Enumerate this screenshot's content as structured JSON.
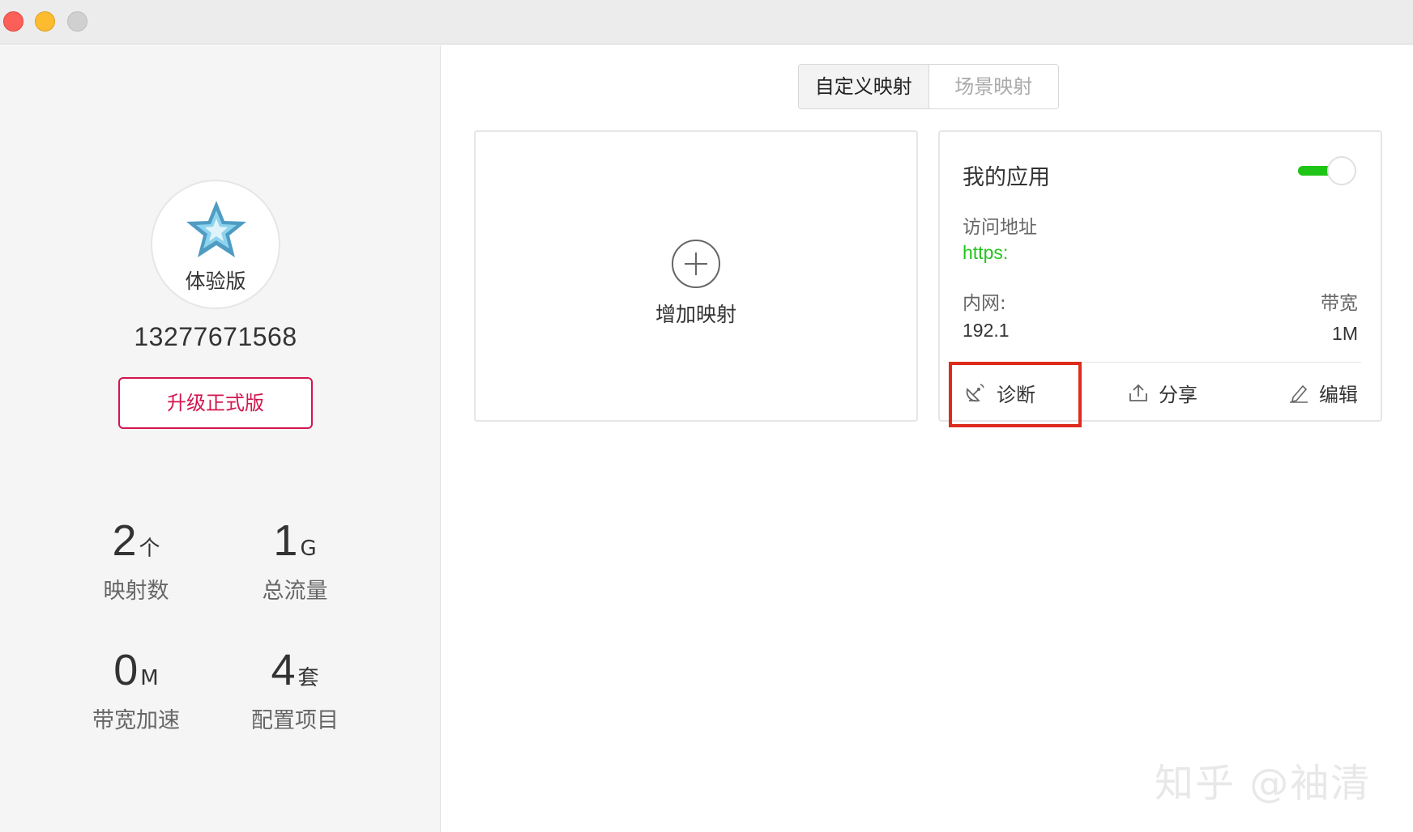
{
  "sidebar": {
    "plan_label": "体验版",
    "phone": "13277671568",
    "upgrade_label": "升级正式版",
    "stats": [
      {
        "value": "2",
        "unit": "个",
        "label": "映射数"
      },
      {
        "value": "1",
        "unit": "G",
        "label": "总流量"
      },
      {
        "value": "0",
        "unit": "M",
        "label": "带宽加速"
      },
      {
        "value": "4",
        "unit": "套",
        "label": "配置项目"
      }
    ]
  },
  "tabs": [
    {
      "label": "自定义映射",
      "active": true
    },
    {
      "label": "场景映射",
      "active": false
    }
  ],
  "add_card": {
    "label": "增加映射"
  },
  "app_card": {
    "title": "我的应用",
    "toggle_on": true,
    "access_label": "访问地址",
    "access_url": "https:",
    "intranet_label": "内网:",
    "intranet_value": "192.1",
    "bandwidth_label": "带宽",
    "bandwidth_value": "1M",
    "actions": {
      "diagnose": "诊断",
      "share": "分享",
      "edit": "编辑"
    }
  },
  "watermark": "知乎 @袖清",
  "colors": {
    "accent_red": "#d3164f",
    "toggle_green": "#1ec516",
    "url_green": "#22c31c",
    "highlight_red": "#dd2b1b"
  },
  "icons": [
    "star-icon",
    "plus-icon",
    "satellite-dish-icon",
    "upload-icon",
    "pencil-icon"
  ]
}
